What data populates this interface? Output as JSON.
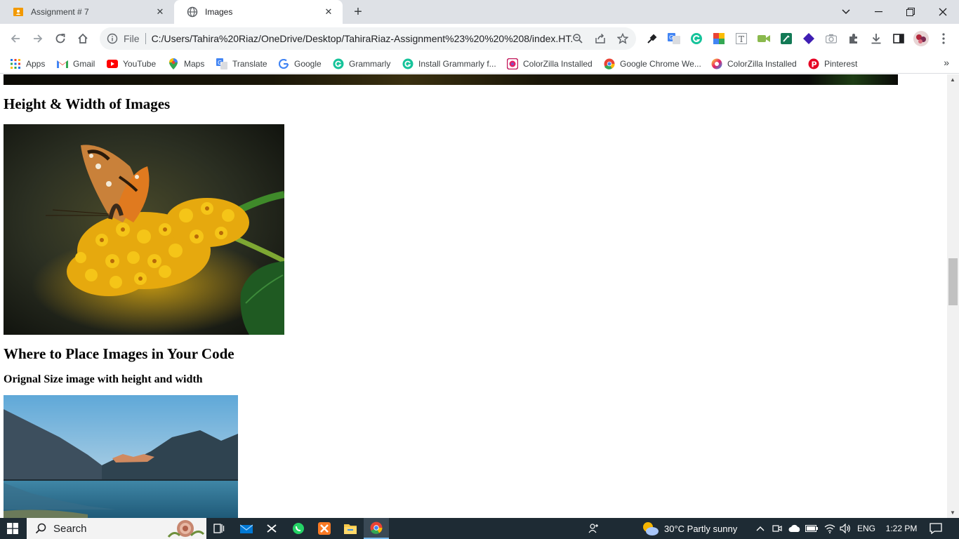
{
  "browser": {
    "tabs": [
      {
        "title": "Assignment # 7",
        "active": false,
        "favicon": "classroom-icon"
      },
      {
        "title": "Images",
        "active": true,
        "favicon": "globe-icon"
      }
    ],
    "omnibox": {
      "scheme_label": "File",
      "url": "C:/Users/Tahira%20Riaz/OneDrive/Desktop/TahiraRiaz-Assignment%23%20%20%208/index.HT..."
    },
    "bookmarks": [
      {
        "label": "Apps",
        "icon": "apps-grid-icon"
      },
      {
        "label": "Gmail",
        "icon": "gmail-icon"
      },
      {
        "label": "YouTube",
        "icon": "youtube-icon"
      },
      {
        "label": "Maps",
        "icon": "maps-pin-icon"
      },
      {
        "label": "Translate",
        "icon": "translate-icon"
      },
      {
        "label": "Google",
        "icon": "google-icon"
      },
      {
        "label": "Grammarly",
        "icon": "grammarly-icon"
      },
      {
        "label": "Install Grammarly f...",
        "icon": "grammarly-icon"
      },
      {
        "label": "ColorZilla Installed",
        "icon": "colorzilla-icon"
      },
      {
        "label": "Google Chrome We...",
        "icon": "chrome-icon"
      },
      {
        "label": "ColorZilla Installed",
        "icon": "colorzilla-icon"
      },
      {
        "label": "Pinterest",
        "icon": "pinterest-icon"
      }
    ]
  },
  "page": {
    "heading_size": "Height & Width of Images",
    "heading_place": "Where to Place Images in Your Code",
    "subheading_original": "Orignal Size image with height and width"
  },
  "taskbar": {
    "search_label": "Search",
    "weather": "30°C  Partly sunny",
    "language": "ENG",
    "time": "1:22 PM"
  }
}
